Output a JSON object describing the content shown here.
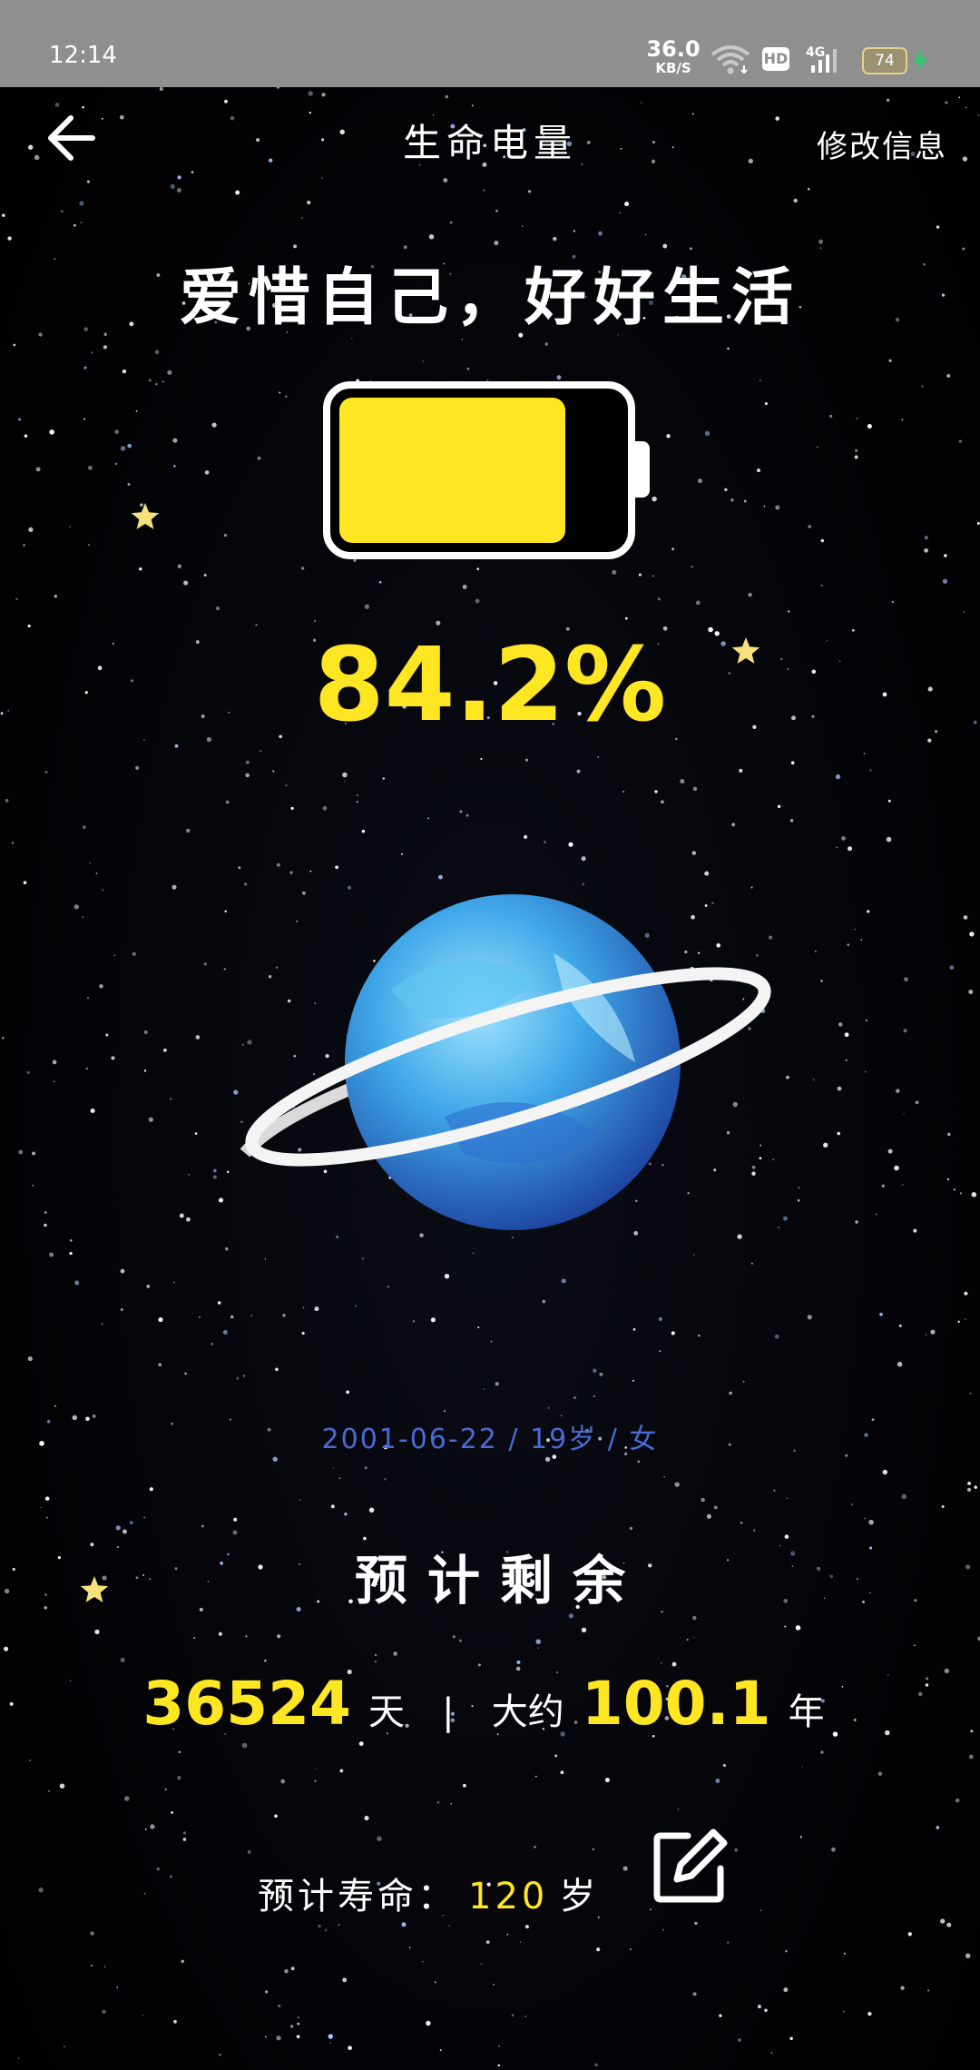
{
  "status_bar": {
    "time": "12:14",
    "net_speed_value": "36.0",
    "net_speed_unit": "KB/S",
    "hd_label": "HD",
    "network_type": "4G",
    "battery_level": "74",
    "icons": [
      "wifi-icon",
      "signal-icon",
      "charging-icon"
    ]
  },
  "header": {
    "back_icon": "arrow-left-icon",
    "title": "生命电量",
    "edit_link": "修改信息"
  },
  "main": {
    "slogan": "爱惜自己，好好生活",
    "battery_fill_fraction": 0.842,
    "life_percent": "84.2%",
    "user_info": "2001-06-22 / 19岁 / 女",
    "remaining_heading": "预计剩余",
    "remaining_days": "36524",
    "days_unit": "天",
    "separator": "|",
    "about_label": "大约",
    "remaining_years": "100.1",
    "years_unit": "年",
    "lifespan_label": "预计寿命：",
    "lifespan_value": "120",
    "lifespan_unit": "岁",
    "edit_icon": "edit-icon"
  },
  "colors": {
    "accent_yellow": "#ffe623",
    "info_blue": "#4a6bd6",
    "status_bar_gray": "#8f8f8f",
    "background": "#000000"
  }
}
